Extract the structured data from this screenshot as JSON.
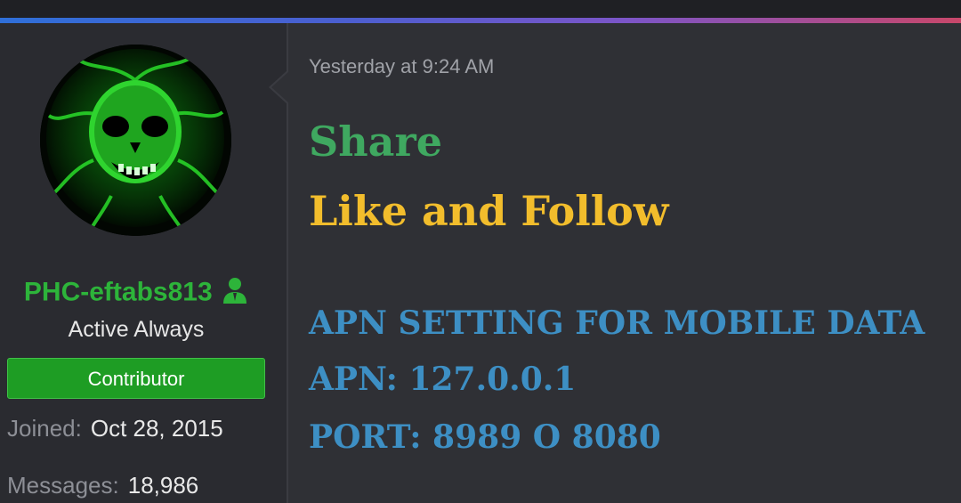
{
  "theme": {
    "username_color": "#2db43a",
    "badge_color": "#1e9d24",
    "share_color": "#3fa860",
    "like_color": "#f2bd2c",
    "apn_color": "#3d8fc4"
  },
  "user": {
    "avatar_icon": "green-skull-avatar",
    "name": "PHC-eftabs813",
    "role_icon": "staff-user-icon",
    "title": "Active Always",
    "badge": "Contributor",
    "joined_label": "Joined:",
    "joined_value": "Oct 28, 2015",
    "messages_label": "Messages:",
    "messages_value": "18,986"
  },
  "post": {
    "timestamp": "Yesterday at 9:24 AM",
    "lines": {
      "share": "Share",
      "like_follow": "Like and Follow",
      "apn_heading": "APN SETTING FOR MOBILE DATA",
      "apn": "APN: 127.0.0.1",
      "port": "PORT: 8989 O 8080"
    }
  }
}
